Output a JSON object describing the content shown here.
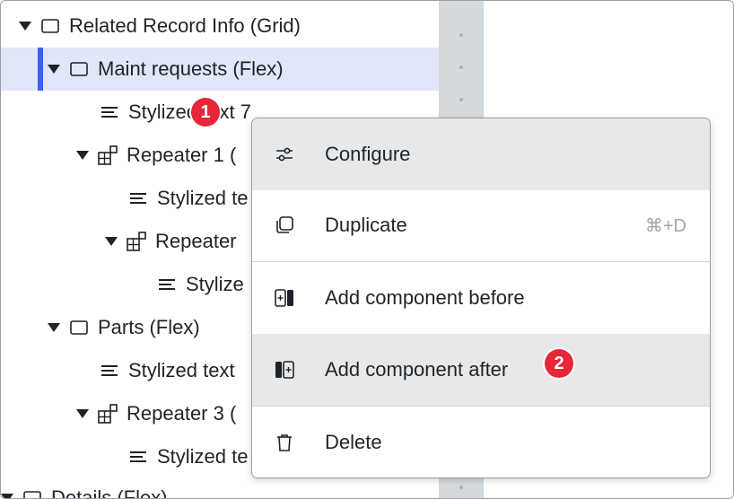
{
  "tree": {
    "items": [
      {
        "label": "Related Record Info (Grid)",
        "icon": "frame-icon"
      },
      {
        "label": "Maint requests (Flex)",
        "icon": "frame-icon",
        "selected": true
      },
      {
        "label": "Stylized text 7",
        "icon": "text-lines-icon"
      },
      {
        "label": "Repeater 1 (",
        "icon": "repeater-icon"
      },
      {
        "label": "Stylized te",
        "icon": "text-lines-icon"
      },
      {
        "label": "Repeater",
        "icon": "repeater-icon"
      },
      {
        "label": "Stylize",
        "icon": "text-lines-icon"
      },
      {
        "label": "Parts (Flex)",
        "icon": "frame-icon"
      },
      {
        "label": "Stylized text",
        "icon": "text-lines-icon"
      },
      {
        "label": "Repeater 3 (",
        "icon": "repeater-icon"
      },
      {
        "label": "Stylized te",
        "icon": "text-lines-icon"
      },
      {
        "label": "Details (Flex)",
        "icon": "frame-icon"
      }
    ]
  },
  "context_menu": {
    "items": [
      {
        "label": "Configure",
        "icon": "sliders-icon",
        "shortcut": ""
      },
      {
        "label": "Duplicate",
        "icon": "duplicate-icon",
        "shortcut": "⌘+D"
      },
      {
        "label": "Add component before",
        "icon": "add-before-icon",
        "shortcut": ""
      },
      {
        "label": "Add component after",
        "icon": "add-after-icon",
        "shortcut": ""
      },
      {
        "label": "Delete",
        "icon": "trash-icon",
        "shortcut": ""
      }
    ]
  },
  "badges": {
    "one": "1",
    "two": "2"
  },
  "colors": {
    "selection_bg": "#dfe7f8",
    "selection_accent": "#3d5ef5",
    "badge": "#e8263a",
    "menu_hover": "#e7e8ea"
  }
}
